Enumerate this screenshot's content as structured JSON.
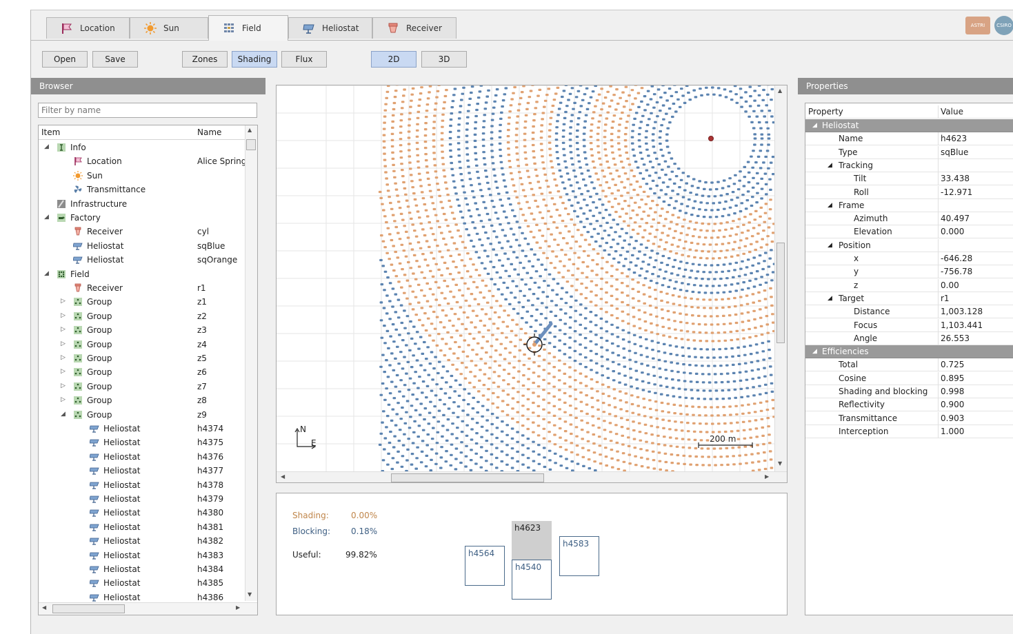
{
  "tabs": [
    {
      "label": "Location",
      "icon": "flag-icon"
    },
    {
      "label": "Sun",
      "icon": "sun-icon"
    },
    {
      "label": "Field",
      "icon": "field-grid-icon"
    },
    {
      "label": "Heliostat",
      "icon": "heliostat-icon"
    },
    {
      "label": "Receiver",
      "icon": "receiver-icon"
    }
  ],
  "logos": {
    "astri": "ASTRI",
    "csiro": "CSIRO"
  },
  "toolbar": {
    "open": "Open",
    "save": "Save",
    "zones": "Zones",
    "shading": "Shading",
    "flux": "Flux",
    "view2d": "2D",
    "view3d": "3D"
  },
  "browser": {
    "title": "Browser",
    "filter_placeholder": "Filter by name",
    "col_item": "Item",
    "col_name": "Name",
    "rows": [
      {
        "label": "Info",
        "name": "",
        "level": 0,
        "tri": "◢",
        "icon": "info"
      },
      {
        "label": "Location",
        "name": "Alice Springs",
        "level": 1,
        "tri": "",
        "icon": "flag"
      },
      {
        "label": "Sun",
        "name": "",
        "level": 1,
        "tri": "",
        "icon": "sun"
      },
      {
        "label": "Transmittance",
        "name": "",
        "level": 1,
        "tri": "",
        "icon": "fan"
      },
      {
        "label": "Infrastructure",
        "name": "",
        "level": 0,
        "tri": "",
        "icon": "infra"
      },
      {
        "label": "Factory",
        "name": "",
        "level": 0,
        "tri": "◢",
        "icon": "factory"
      },
      {
        "label": "Receiver",
        "name": "cyl",
        "level": 1,
        "tri": "",
        "icon": "receiver"
      },
      {
        "label": "Heliostat",
        "name": "sqBlue",
        "level": 1,
        "tri": "",
        "icon": "heliostat"
      },
      {
        "label": "Heliostat",
        "name": "sqOrange",
        "level": 1,
        "tri": "",
        "icon": "heliostat"
      },
      {
        "label": "Field",
        "name": "",
        "level": 0,
        "tri": "◢",
        "icon": "field"
      },
      {
        "label": "Receiver",
        "name": "r1",
        "level": 1,
        "tri": "",
        "icon": "receiver"
      },
      {
        "label": "Group",
        "name": "z1",
        "level": 1,
        "tri": "▷",
        "icon": "group"
      },
      {
        "label": "Group",
        "name": "z2",
        "level": 1,
        "tri": "▷",
        "icon": "group"
      },
      {
        "label": "Group",
        "name": "z3",
        "level": 1,
        "tri": "▷",
        "icon": "group"
      },
      {
        "label": "Group",
        "name": "z4",
        "level": 1,
        "tri": "▷",
        "icon": "group"
      },
      {
        "label": "Group",
        "name": "z5",
        "level": 1,
        "tri": "▷",
        "icon": "group"
      },
      {
        "label": "Group",
        "name": "z6",
        "level": 1,
        "tri": "▷",
        "icon": "group"
      },
      {
        "label": "Group",
        "name": "z7",
        "level": 1,
        "tri": "▷",
        "icon": "group"
      },
      {
        "label": "Group",
        "name": "z8",
        "level": 1,
        "tri": "▷",
        "icon": "group"
      },
      {
        "label": "Group",
        "name": "z9",
        "level": 1,
        "tri": "◢",
        "icon": "group"
      },
      {
        "label": "Heliostat",
        "name": "h4374",
        "level": 2,
        "tri": "",
        "icon": "heliostat"
      },
      {
        "label": "Heliostat",
        "name": "h4375",
        "level": 2,
        "tri": "",
        "icon": "heliostat"
      },
      {
        "label": "Heliostat",
        "name": "h4376",
        "level": 2,
        "tri": "",
        "icon": "heliostat"
      },
      {
        "label": "Heliostat",
        "name": "h4377",
        "level": 2,
        "tri": "",
        "icon": "heliostat"
      },
      {
        "label": "Heliostat",
        "name": "h4378",
        "level": 2,
        "tri": "",
        "icon": "heliostat"
      },
      {
        "label": "Heliostat",
        "name": "h4379",
        "level": 2,
        "tri": "",
        "icon": "heliostat"
      },
      {
        "label": "Heliostat",
        "name": "h4380",
        "level": 2,
        "tri": "",
        "icon": "heliostat"
      },
      {
        "label": "Heliostat",
        "name": "h4381",
        "level": 2,
        "tri": "",
        "icon": "heliostat"
      },
      {
        "label": "Heliostat",
        "name": "h4382",
        "level": 2,
        "tri": "",
        "icon": "heliostat"
      },
      {
        "label": "Heliostat",
        "name": "h4383",
        "level": 2,
        "tri": "",
        "icon": "heliostat"
      },
      {
        "label": "Heliostat",
        "name": "h4384",
        "level": 2,
        "tri": "",
        "icon": "heliostat"
      },
      {
        "label": "Heliostat",
        "name": "h4385",
        "level": 2,
        "tri": "",
        "icon": "heliostat"
      },
      {
        "label": "Heliostat",
        "name": "h4386",
        "level": 2,
        "tri": "",
        "icon": "heliostat"
      }
    ]
  },
  "view": {
    "scale_label": "200 m",
    "compass_n": "N",
    "compass_e": "E",
    "colors": {
      "blue": "#5b83b0",
      "orange": "#e0a171"
    }
  },
  "shading_info": {
    "shading_label": "Shading:",
    "shading_value": "0.00%",
    "blocking_label": "Blocking:",
    "blocking_value": "0.18%",
    "useful_label": "Useful:",
    "useful_value": "99.82%",
    "selected": "h4623",
    "neighbors": [
      "h4564",
      "h4540",
      "h4583"
    ]
  },
  "properties": {
    "title": "Properties",
    "col_property": "Property",
    "col_value": "Value",
    "rows": [
      {
        "key": "Heliostat",
        "value": "",
        "level": 0,
        "section": true
      },
      {
        "key": "Name",
        "value": "h4623",
        "level": 1
      },
      {
        "key": "Type",
        "value": "sqBlue",
        "level": 1
      },
      {
        "key": "Tracking",
        "value": "",
        "level": 1,
        "tri": "◢"
      },
      {
        "key": "Tilt",
        "value": "33.438",
        "level": 2
      },
      {
        "key": "Roll",
        "value": "-12.971",
        "level": 2
      },
      {
        "key": "Frame",
        "value": "",
        "level": 1,
        "tri": "◢"
      },
      {
        "key": "Azimuth",
        "value": "40.497",
        "level": 2
      },
      {
        "key": "Elevation",
        "value": "0.000",
        "level": 2
      },
      {
        "key": "Position",
        "value": "",
        "level": 1,
        "tri": "◢"
      },
      {
        "key": "x",
        "value": "-646.28",
        "level": 2
      },
      {
        "key": "y",
        "value": "-756.78",
        "level": 2
      },
      {
        "key": "z",
        "value": "0.00",
        "level": 2
      },
      {
        "key": "Target",
        "value": "r1",
        "level": 1,
        "tri": "◢"
      },
      {
        "key": "Distance",
        "value": "1,003.128",
        "level": 2
      },
      {
        "key": "Focus",
        "value": "1,103.441",
        "level": 2
      },
      {
        "key": "Angle",
        "value": "26.553",
        "level": 2
      },
      {
        "key": "Efficiencies",
        "value": "",
        "level": 0,
        "section": true
      },
      {
        "key": "Total",
        "value": "0.725",
        "level": 1
      },
      {
        "key": "Cosine",
        "value": "0.895",
        "level": 1
      },
      {
        "key": "Shading and blocking",
        "value": "0.998",
        "level": 1
      },
      {
        "key": "Reflectivity",
        "value": "0.900",
        "level": 1
      },
      {
        "key": "Transmittance",
        "value": "0.903",
        "level": 1
      },
      {
        "key": "Interception",
        "value": "1.000",
        "level": 1
      }
    ]
  }
}
